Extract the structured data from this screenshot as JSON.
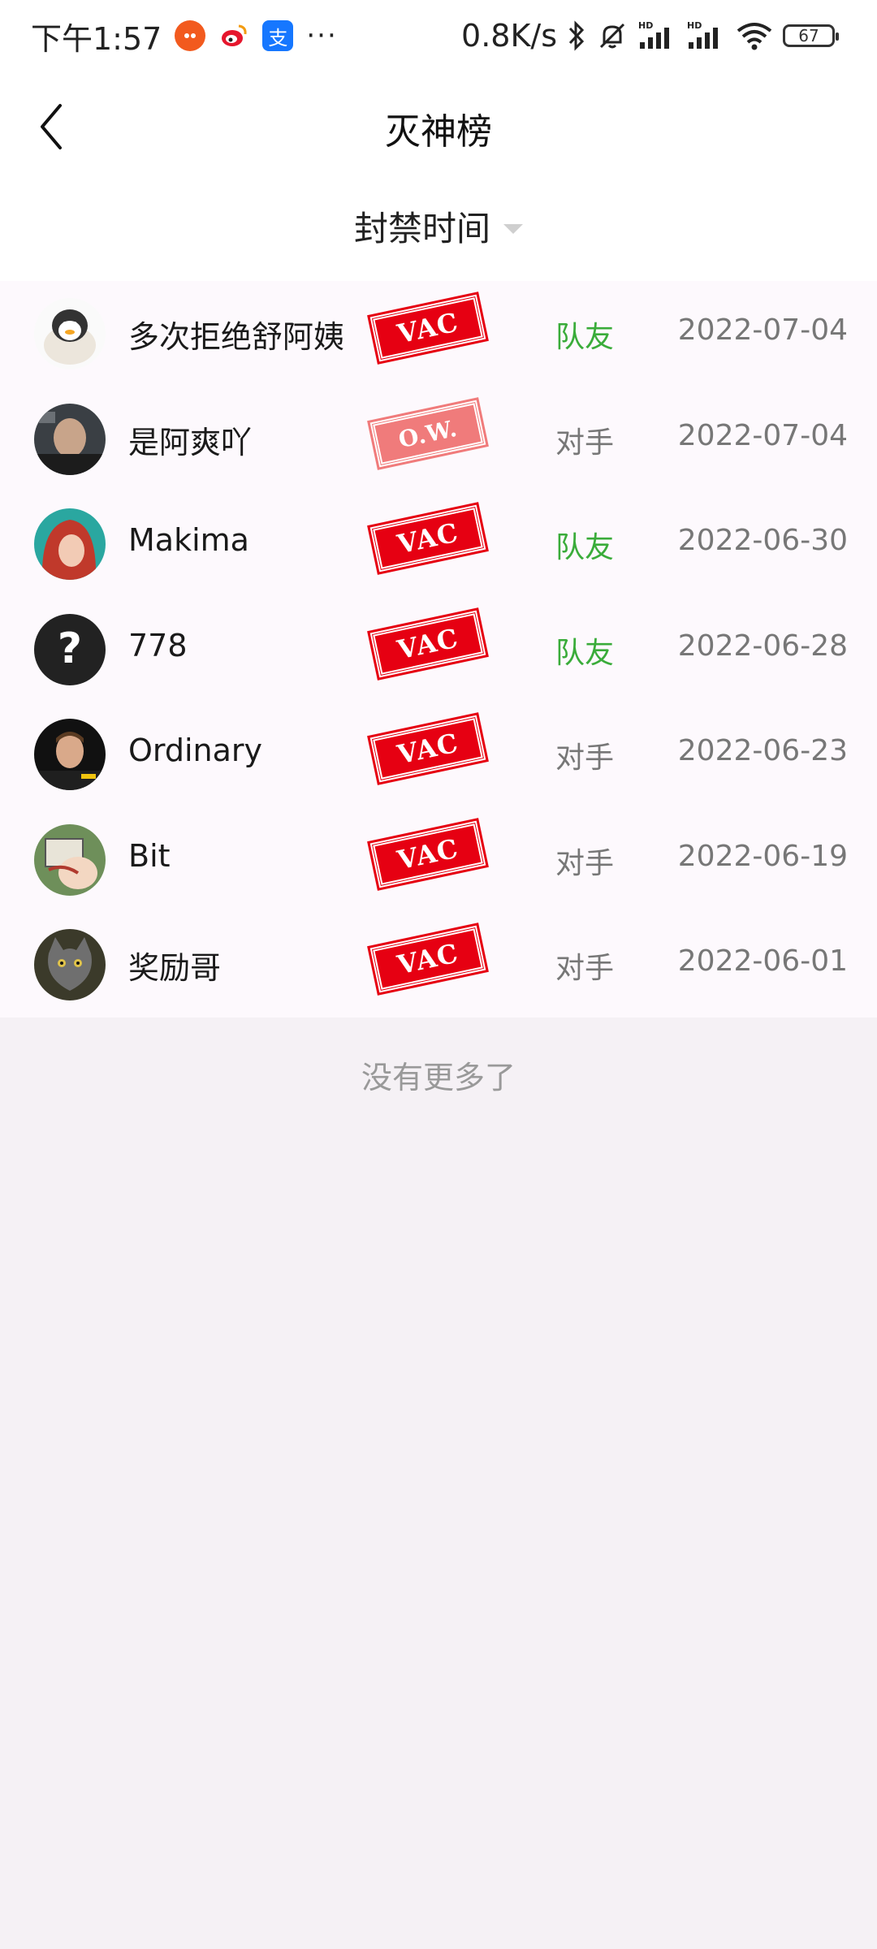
{
  "status_bar": {
    "time": "下午1:57",
    "net_speed": "0.8K/s",
    "battery": "67",
    "more": "···",
    "alipay_glyph": "支",
    "signal_hd_label": "HD"
  },
  "header": {
    "title": "灭神榜"
  },
  "filter": {
    "sort_label": "封禁时间"
  },
  "list": [
    {
      "name": "多次拒绝舒阿姨",
      "ban": "VAC",
      "ban_kind": "vac",
      "role": "队友",
      "role_kind": "teammate",
      "date": "2022-07-04"
    },
    {
      "name": "是阿爽吖",
      "ban": "O.W.",
      "ban_kind": "ow",
      "role": "对手",
      "role_kind": "opponent",
      "date": "2022-07-04"
    },
    {
      "name": "Makima",
      "ban": "VAC",
      "ban_kind": "vac",
      "role": "队友",
      "role_kind": "teammate",
      "date": "2022-06-30"
    },
    {
      "name": "778",
      "ban": "VAC",
      "ban_kind": "vac",
      "role": "队友",
      "role_kind": "teammate",
      "date": "2022-06-28"
    },
    {
      "name": "Ordinary",
      "ban": "VAC",
      "ban_kind": "vac",
      "role": "对手",
      "role_kind": "opponent",
      "date": "2022-06-23"
    },
    {
      "name": "Bit",
      "ban": "VAC",
      "ban_kind": "vac",
      "role": "对手",
      "role_kind": "opponent",
      "date": "2022-06-19"
    },
    {
      "name": "奖励哥",
      "ban": "VAC",
      "ban_kind": "vac",
      "role": "对手",
      "role_kind": "opponent",
      "date": "2022-06-01"
    }
  ],
  "avatar_unknown_glyph": "?",
  "footer": {
    "end_text": "没有更多了"
  },
  "colors": {
    "teammate": "#3aac3a",
    "opponent": "#777777",
    "vac_stamp": "#e60012",
    "ow_stamp": "#f07b7b",
    "page_bg": "#f5f1f5"
  }
}
